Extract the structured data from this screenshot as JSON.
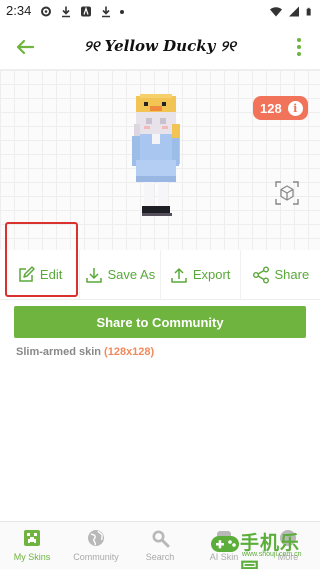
{
  "status_bar": {
    "time": "2:34"
  },
  "app_bar": {
    "title": "୨୧ Yellow Ducky ୨୧"
  },
  "preview": {
    "badge_count": "128",
    "info_glyph": "i"
  },
  "actions": [
    {
      "label": "Edit"
    },
    {
      "label": "Save As"
    },
    {
      "label": "Export"
    },
    {
      "label": "Share"
    }
  ],
  "share_button": {
    "label": "Share to Community"
  },
  "skin_info": {
    "text": "Slim-armed skin",
    "dimensions": "(128x128)"
  },
  "bottom_nav": {
    "items": [
      {
        "label": "My Skins",
        "icon": "creeper-icon",
        "active": true
      },
      {
        "label": "Community",
        "icon": "globe-icon"
      },
      {
        "label": "Search",
        "icon": "search-icon"
      },
      {
        "label": "AI Skin",
        "icon": "ai-icon"
      },
      {
        "label": "More",
        "icon": "more-icon"
      }
    ]
  },
  "watermark": {
    "text": "手机乐园",
    "url": "www.shouji.com.cn"
  },
  "colors": {
    "accent_green": "#6fb43f",
    "badge_orange": "#f0735a",
    "highlight_red": "#d9322e"
  }
}
